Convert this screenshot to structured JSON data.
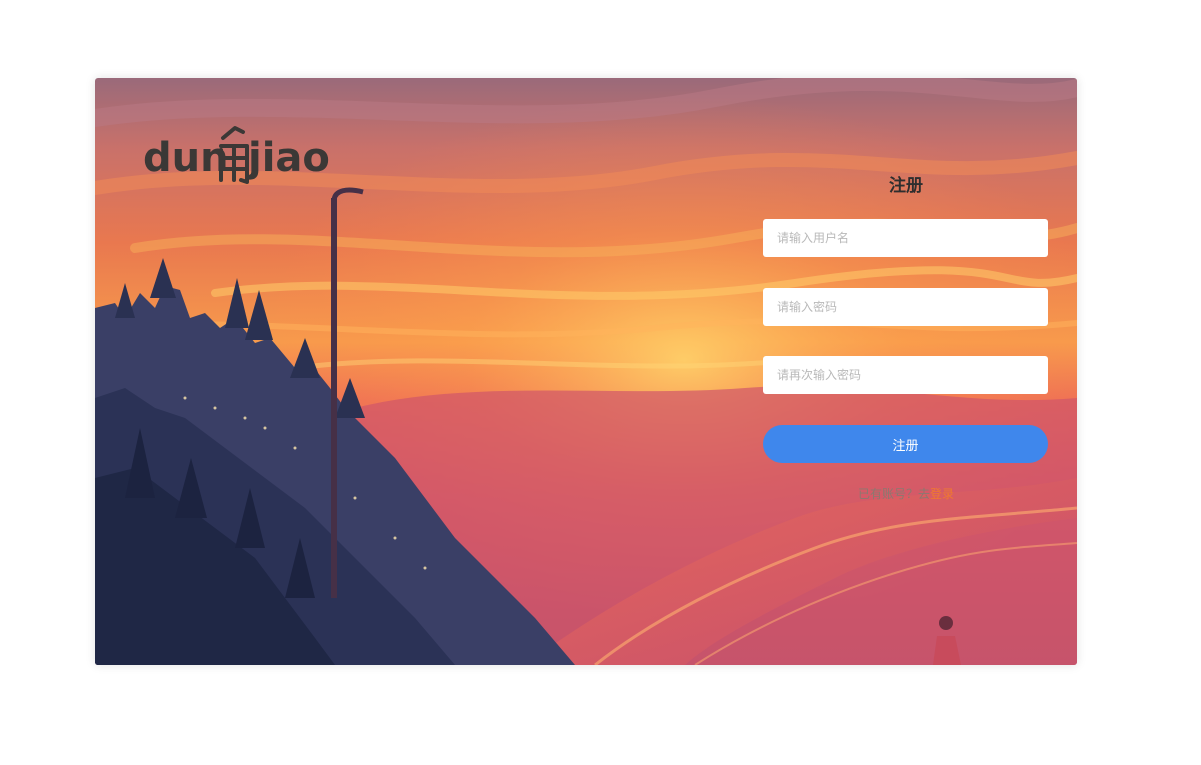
{
  "logo": {
    "left_text": "dun",
    "glyph": "角",
    "right_text": "jiao"
  },
  "register_form": {
    "title": "注册",
    "username_placeholder": "请输入用户名",
    "password_placeholder": "请输入密码",
    "confirm_placeholder": "请再次输入密码",
    "submit_label": "注册",
    "have_account_text": "已有账号？去",
    "login_link_label": "登录"
  },
  "colors": {
    "submit_button": "#3f87ec",
    "login_link": "#f07a2e",
    "sky_top": "#9a6a7a",
    "sky_glow": "#f7a24c",
    "hills": "#2f3a5c"
  }
}
